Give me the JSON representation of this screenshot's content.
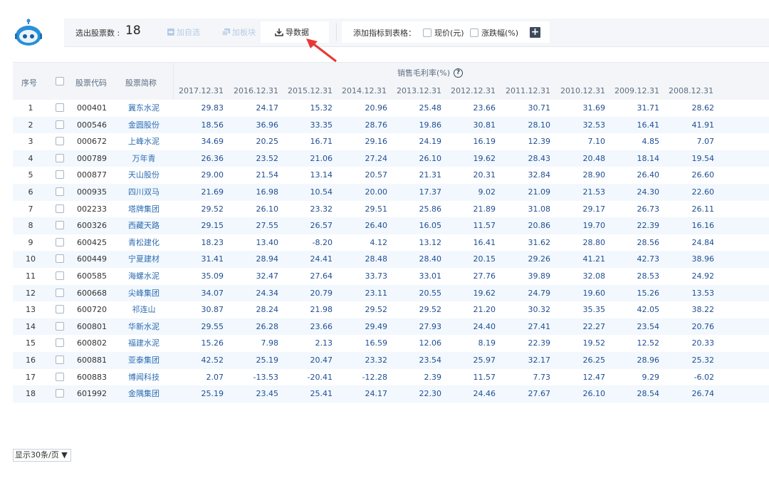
{
  "toolbar": {
    "count_label": "选出股票数 :",
    "count_value": "18",
    "add_watchlist": "加自选",
    "add_sector": "加板块",
    "export_data": "导数据",
    "add_indicator_label": "添加指标到表格：",
    "indicator_options": [
      "现价(元)",
      "涨跌幅(%)"
    ],
    "plus": "+"
  },
  "table": {
    "col_index": "序号",
    "col_code": "股票代码",
    "col_name": "股票简称",
    "group_title": "销售毛利率(%)",
    "help": "?",
    "years": [
      "2017.12.31",
      "2016.12.31",
      "2015.12.31",
      "2014.12.31",
      "2013.12.31",
      "2012.12.31",
      "2011.12.31",
      "2010.12.31",
      "2009.12.31",
      "2008.12.31"
    ],
    "rows": [
      {
        "idx": "1",
        "code": "000401",
        "name": "冀东水泥",
        "vals": [
          "29.83",
          "24.17",
          "15.32",
          "20.96",
          "25.48",
          "23.66",
          "30.71",
          "31.69",
          "31.71",
          "28.62"
        ]
      },
      {
        "idx": "2",
        "code": "000546",
        "name": "金圆股份",
        "vals": [
          "18.56",
          "36.96",
          "33.35",
          "28.76",
          "19.86",
          "30.81",
          "28.10",
          "32.53",
          "16.41",
          "41.91"
        ]
      },
      {
        "idx": "3",
        "code": "000672",
        "name": "上峰水泥",
        "vals": [
          "34.69",
          "20.25",
          "16.71",
          "29.16",
          "24.19",
          "16.19",
          "12.39",
          "7.10",
          "4.85",
          "7.07"
        ]
      },
      {
        "idx": "4",
        "code": "000789",
        "name": "万年青",
        "vals": [
          "26.36",
          "23.52",
          "21.06",
          "27.24",
          "26.10",
          "19.62",
          "28.43",
          "20.48",
          "18.14",
          "19.54"
        ]
      },
      {
        "idx": "5",
        "code": "000877",
        "name": "天山股份",
        "vals": [
          "29.00",
          "21.54",
          "13.14",
          "20.57",
          "21.31",
          "20.31",
          "32.84",
          "28.90",
          "26.40",
          "26.60"
        ]
      },
      {
        "idx": "6",
        "code": "000935",
        "name": "四川双马",
        "vals": [
          "21.69",
          "16.98",
          "10.54",
          "20.00",
          "17.37",
          "9.02",
          "21.09",
          "21.53",
          "24.30",
          "22.60"
        ]
      },
      {
        "idx": "7",
        "code": "002233",
        "name": "塔牌集团",
        "vals": [
          "29.52",
          "26.10",
          "23.32",
          "29.51",
          "25.86",
          "21.89",
          "31.08",
          "29.17",
          "26.73",
          "26.11"
        ]
      },
      {
        "idx": "8",
        "code": "600326",
        "name": "西藏天路",
        "vals": [
          "29.15",
          "27.55",
          "26.57",
          "26.40",
          "16.05",
          "11.57",
          "20.86",
          "19.70",
          "22.39",
          "16.16"
        ]
      },
      {
        "idx": "9",
        "code": "600425",
        "name": "青松建化",
        "vals": [
          "18.23",
          "13.40",
          "-8.20",
          "4.12",
          "13.12",
          "16.41",
          "31.62",
          "28.80",
          "28.56",
          "24.84"
        ]
      },
      {
        "idx": "10",
        "code": "600449",
        "name": "宁夏建材",
        "vals": [
          "31.41",
          "28.94",
          "24.41",
          "28.48",
          "28.40",
          "20.15",
          "29.26",
          "41.21",
          "42.73",
          "38.96"
        ]
      },
      {
        "idx": "11",
        "code": "600585",
        "name": "海螺水泥",
        "vals": [
          "35.09",
          "32.47",
          "27.64",
          "33.73",
          "33.01",
          "27.76",
          "39.89",
          "32.08",
          "28.53",
          "24.92"
        ]
      },
      {
        "idx": "12",
        "code": "600668",
        "name": "尖峰集团",
        "vals": [
          "34.07",
          "24.34",
          "20.79",
          "23.11",
          "20.55",
          "19.62",
          "24.79",
          "19.60",
          "15.26",
          "13.53"
        ]
      },
      {
        "idx": "13",
        "code": "600720",
        "name": "祁连山",
        "vals": [
          "30.87",
          "28.24",
          "21.98",
          "29.52",
          "29.52",
          "21.20",
          "30.32",
          "35.35",
          "42.05",
          "38.22"
        ]
      },
      {
        "idx": "14",
        "code": "600801",
        "name": "华新水泥",
        "vals": [
          "29.55",
          "26.28",
          "23.66",
          "29.49",
          "27.93",
          "24.40",
          "27.41",
          "22.27",
          "23.54",
          "20.76"
        ]
      },
      {
        "idx": "15",
        "code": "600802",
        "name": "福建水泥",
        "vals": [
          "15.26",
          "7.98",
          "2.13",
          "16.59",
          "12.06",
          "8.19",
          "22.39",
          "19.52",
          "12.52",
          "20.33"
        ]
      },
      {
        "idx": "16",
        "code": "600881",
        "name": "亚泰集团",
        "vals": [
          "42.52",
          "25.19",
          "20.47",
          "23.32",
          "23.54",
          "25.97",
          "32.17",
          "26.25",
          "28.96",
          "25.32"
        ]
      },
      {
        "idx": "17",
        "code": "600883",
        "name": "博闻科技",
        "vals": [
          "2.07",
          "-13.53",
          "-20.41",
          "-12.28",
          "2.39",
          "11.57",
          "7.73",
          "12.47",
          "9.29",
          "-6.02"
        ]
      },
      {
        "idx": "18",
        "code": "601992",
        "name": "金隅集团",
        "vals": [
          "25.19",
          "23.45",
          "25.41",
          "24.17",
          "22.30",
          "24.46",
          "27.67",
          "26.10",
          "28.54",
          "26.74"
        ]
      }
    ]
  },
  "pager": {
    "per_page": "显示30条/页 ▼"
  },
  "colors": {
    "header_bg": "#f3f5f8",
    "alt_row": "#f2f8fd",
    "link": "#2e6db3",
    "number": "#1f4e93",
    "arrow": "#e53935"
  }
}
